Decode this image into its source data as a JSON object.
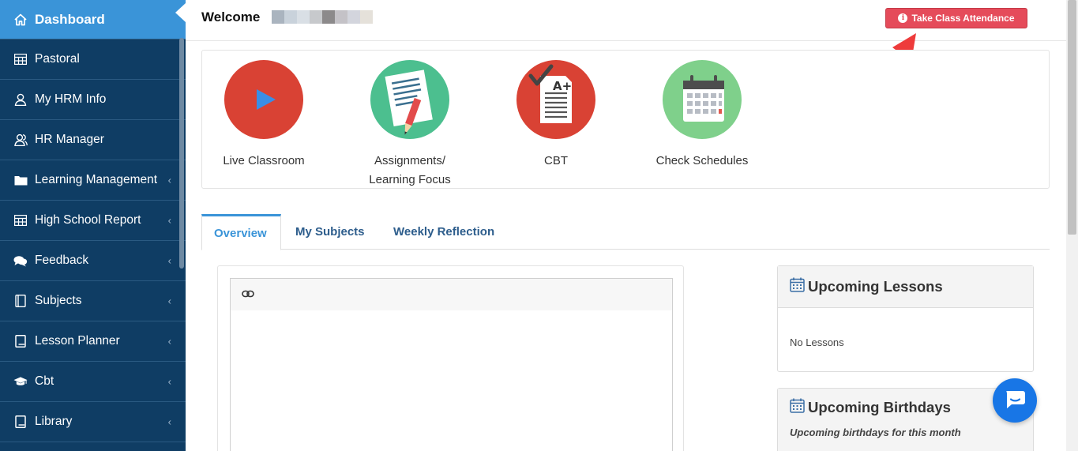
{
  "sidebar": {
    "items": [
      {
        "label": "Dashboard",
        "icon": "home-icon",
        "active": true,
        "has_chevron": false
      },
      {
        "label": "Pastoral",
        "icon": "table-icon",
        "has_chevron": false
      },
      {
        "label": "My HRM Info",
        "icon": "user-icon",
        "has_chevron": false
      },
      {
        "label": "HR Manager",
        "icon": "users-icon",
        "has_chevron": false
      },
      {
        "label": "Learning Management",
        "icon": "folder-icon",
        "has_chevron": true
      },
      {
        "label": "High School Report",
        "icon": "table-icon",
        "has_chevron": true
      },
      {
        "label": "Feedback",
        "icon": "comments-icon",
        "has_chevron": true
      },
      {
        "label": "Subjects",
        "icon": "book-icon",
        "has_chevron": true
      },
      {
        "label": "Lesson Planner",
        "icon": "notebook-icon",
        "has_chevron": true
      },
      {
        "label": "Cbt",
        "icon": "graduation-cap-icon",
        "has_chevron": true
      },
      {
        "label": "Library",
        "icon": "book-icon",
        "has_chevron": true
      }
    ],
    "chevron": "‹",
    "bg_color": "#0f3d64",
    "active_color": "#3a94d8"
  },
  "header": {
    "welcome": "Welcome",
    "attendance_button": "Take Class Attendance",
    "attendance_color": "#e54b5a"
  },
  "tiles": [
    {
      "label": "Live Classroom",
      "icon": "play-icon",
      "color": "#d94234"
    },
    {
      "label": "Assignments/ Learning Focus",
      "icon": "document-pencil-icon",
      "color": "#4cbf8f"
    },
    {
      "label": "CBT",
      "icon": "graded-paper-icon",
      "color": "#d94234"
    },
    {
      "label": "Check Schedules",
      "icon": "calendar-icon",
      "color": "#7fd08b"
    }
  ],
  "tabs": [
    {
      "label": "Overview",
      "active": true
    },
    {
      "label": "My Subjects",
      "active": false
    },
    {
      "label": "Weekly Reflection",
      "active": false
    }
  ],
  "cards": {
    "lessons": {
      "title": "Upcoming Lessons",
      "body": "No Lessons"
    },
    "birthdays": {
      "title": "Upcoming Birthdays",
      "subtitle": "Upcoming birthdays for this month"
    }
  }
}
